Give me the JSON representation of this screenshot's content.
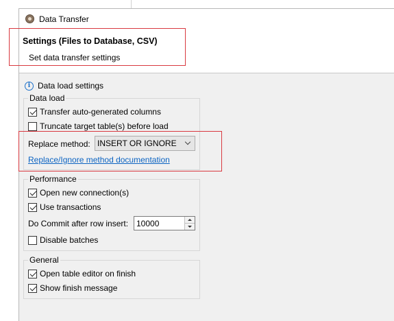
{
  "window": {
    "title": "Data Transfer"
  },
  "header": {
    "title": "Settings (Files to Database, CSV)",
    "description": "Set data transfer settings"
  },
  "section": {
    "label": "Data load settings",
    "icon": "info-icon"
  },
  "data_load": {
    "title": "Data load",
    "transfer_auto_generated": {
      "label": "Transfer auto-generated columns",
      "checked": true
    },
    "truncate_target": {
      "label": "Truncate target table(s) before load",
      "checked": false
    },
    "replace_method": {
      "label": "Replace method:",
      "value": "INSERT OR IGNORE"
    },
    "doc_link": "Replace/Ignore method documentation"
  },
  "performance": {
    "title": "Performance",
    "open_new_connection": {
      "label": "Open new connection(s)",
      "checked": true
    },
    "use_transactions": {
      "label": "Use transactions",
      "checked": true
    },
    "commit_after": {
      "label": "Do Commit after row insert:",
      "value": "10000"
    },
    "disable_batches": {
      "label": "Disable batches",
      "checked": false
    }
  },
  "general": {
    "title": "General",
    "open_table_editor": {
      "label": "Open table editor on finish",
      "checked": true
    },
    "show_finish_message": {
      "label": "Show finish message",
      "checked": true
    }
  },
  "colors": {
    "link": "#0b63c2",
    "highlight": "#d9383f",
    "dialog_bg": "#f0f0f0",
    "info": "#1a6fc9"
  }
}
